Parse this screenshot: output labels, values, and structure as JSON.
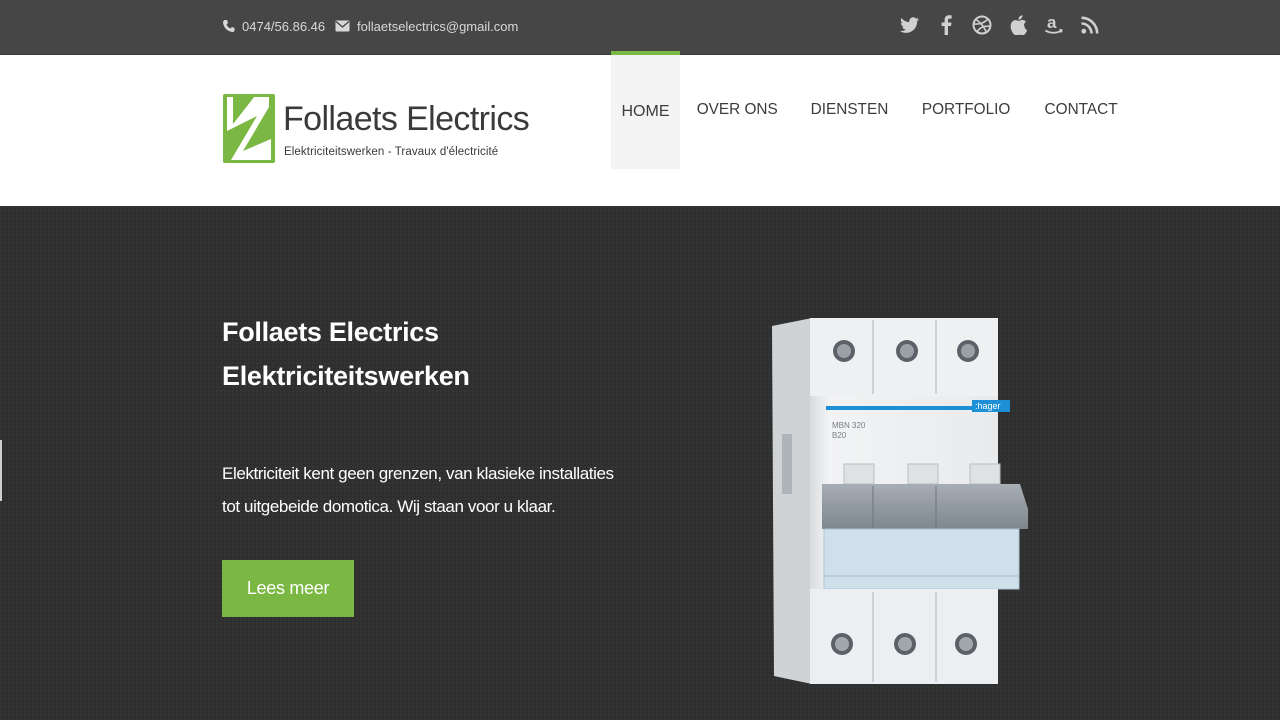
{
  "topbar": {
    "phone": "0474/56.86.46",
    "email": "follaetselectrics@gmail.com",
    "icons": [
      "phone-icon",
      "envelope-icon"
    ],
    "socials": [
      "twitter-icon",
      "facebook-icon",
      "dribbble-icon",
      "apple-icon",
      "amazon-icon",
      "rss-icon"
    ]
  },
  "logo": {
    "title": "Follaets Electrics",
    "subtitle": "Elektriciteitswerken  -  Travaux d'électricité",
    "mark": "lightning-logo-icon"
  },
  "nav": {
    "items": [
      {
        "label": "HOME",
        "active": true
      },
      {
        "label": "OVER ONS",
        "active": false
      },
      {
        "label": "DIENSTEN",
        "active": false
      },
      {
        "label": "PORTFOLIO",
        "active": false
      },
      {
        "label": "CONTACT",
        "active": false
      }
    ]
  },
  "hero": {
    "title_line1": "Follaets Electrics",
    "title_line2": "Elektriciteitswerken",
    "text": "Elektriciteit kent geen grenzen, van klasieke installaties tot uitgebeide domotica. Wij staan voor u klaar.",
    "button": "Lees meer",
    "product_brand": ":hager",
    "product_model": "MBN 320",
    "product_rating": "B20"
  },
  "colors": {
    "accent": "#7ab843",
    "topbar": "#464646",
    "hero": "#2f2f2f"
  }
}
